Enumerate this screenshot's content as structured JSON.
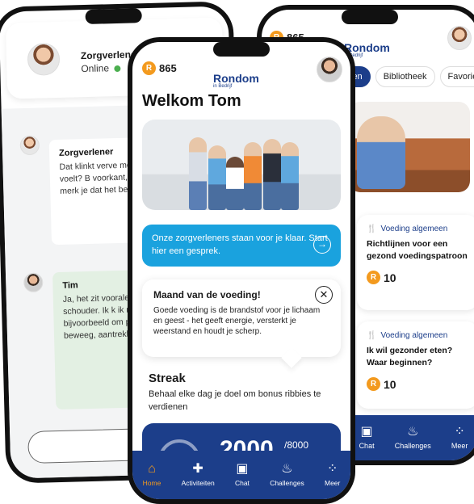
{
  "chat_phone": {
    "contact_name": "Zorgverlener",
    "status": "Online",
    "messages": [
      {
        "sender": "Zorgverlener",
        "text": "Dat klinkt verve meer vertellen o precies voelt? B voorkant, achte de zijkant van d merk je dat het bewegingen erg"
      },
      {
        "sender": "Tim",
        "text": "Ja, het zit voorale en een beetje a de schouder. Ik k ik mijn arm bove bijvoorbeeld om pakken, of als ik achter beweeg, aantrekken van het meteen."
      }
    ]
  },
  "home_phone": {
    "coins": "865",
    "logo": "Rondom",
    "logo_sub": "in Bedrijf",
    "welcome": "Welkom Tom",
    "cta_text": "Onze zorgverleners staan voor je klaar. Start hier een gesprek.",
    "month_card": {
      "title": "Maand van de voeding!",
      "text": "Goede voeding is de brandstof voor je lichaam en geest - het geeft energie, versterkt je weerstand en houdt je scherp."
    },
    "streak": {
      "title": "Streak",
      "text": "Behaal elke dag je doel om bonus ribbies te verdienen",
      "value": "2000",
      "goal": "/8000"
    },
    "nav": [
      {
        "label": "Home",
        "icon": "home-icon"
      },
      {
        "label": "Activiteiten",
        "icon": "puzzle-icon"
      },
      {
        "label": "Chat",
        "icon": "chat-icon"
      },
      {
        "label": "Challenges",
        "icon": "flame-icon"
      },
      {
        "label": "Meer",
        "icon": "dots-icon"
      }
    ]
  },
  "library_phone": {
    "coins": "865",
    "logo": "Rondom",
    "logo_sub": "in Bedrijf",
    "tabs": [
      "len",
      "Bibliotheek",
      "Favorie"
    ],
    "cards": [
      {
        "category": "Voeding algemeen",
        "title": "Richtlijnen voor een gezond voedingspatroon",
        "points": "10"
      },
      {
        "category": "Voeding algemeen",
        "title": "Ik wil gezonder eten? Waar beginnen?",
        "points": "10"
      }
    ],
    "nav": [
      {
        "label": "Chat",
        "icon": "chat-icon"
      },
      {
        "label": "Challenges",
        "icon": "flame-icon"
      },
      {
        "label": "Meer",
        "icon": "dots-icon"
      }
    ]
  },
  "colors": {
    "brand_blue": "#1c3e8a",
    "accent_orange": "#f39a1e",
    "cta_blue": "#1aa2de"
  }
}
